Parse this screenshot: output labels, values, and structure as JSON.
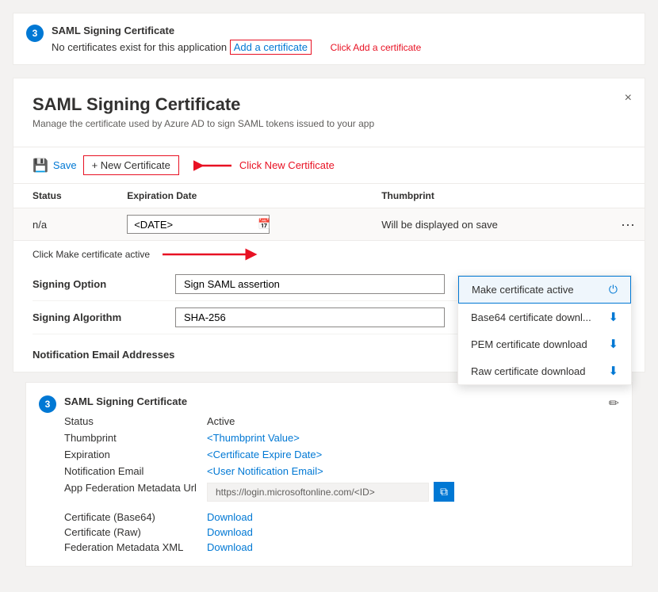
{
  "steps": {
    "step1": "3",
    "step2": "3"
  },
  "top_box": {
    "title": "SAML Signing Certificate",
    "body_text": "No certificates exist for this application",
    "add_link": "Add a certificate",
    "hint": "Click Add a certificate"
  },
  "panel": {
    "title": "SAML Signing Certificate",
    "subtitle": "Manage the certificate used by Azure AD to sign SAML tokens issued to your app",
    "close_label": "×"
  },
  "toolbar": {
    "save_label": "Save",
    "new_cert_label": "+ New Certificate",
    "hint": "Click New Certificate"
  },
  "table": {
    "headers": [
      "Status",
      "Expiration Date",
      "Thumbprint"
    ],
    "row": {
      "status": "n/a",
      "date": "<DATE>",
      "thumbprint_hint": "Will be displayed on save"
    }
  },
  "annotation": {
    "text": "Click Make certificate active"
  },
  "dropdown": {
    "items": [
      {
        "label": "Make certificate active",
        "icon": "power"
      },
      {
        "label": "Base64 certificate downl...",
        "icon": "download"
      },
      {
        "label": "PEM certificate download",
        "icon": "download"
      },
      {
        "label": "Raw certificate download",
        "icon": "download"
      }
    ]
  },
  "fields": [
    {
      "label": "Signing Option",
      "value": "Sign SAML assertion"
    },
    {
      "label": "Signing Algorithm",
      "value": "SHA-256"
    }
  ],
  "notification": {
    "title": "Notification Email Addresses"
  },
  "bottom_box": {
    "title": "SAML Signing Certificate",
    "fields": [
      {
        "label": "Status",
        "value": "Active",
        "type": "normal"
      },
      {
        "label": "Thumbprint",
        "value": "<Thumbprint Value>",
        "type": "placeholder"
      },
      {
        "label": "Expiration",
        "value": "<Certificate Expire Date>",
        "type": "placeholder"
      },
      {
        "label": "Notification Email",
        "value": "<User Notification Email>",
        "type": "placeholder"
      },
      {
        "label": "App Federation Metadata Url",
        "value": "https://login.microsoftonline.com/<ID>",
        "type": "url"
      }
    ],
    "downloads": [
      {
        "label": "Certificate (Base64)",
        "link_text": "Download"
      },
      {
        "label": "Certificate (Raw)",
        "link_text": "Download"
      },
      {
        "label": "Federation Metadata XML",
        "link_text": "Download"
      }
    ]
  }
}
